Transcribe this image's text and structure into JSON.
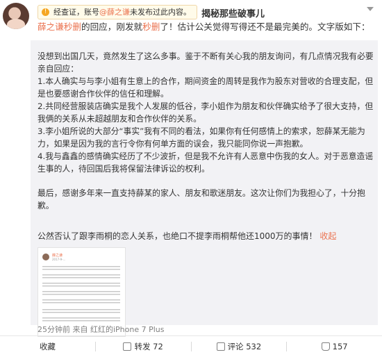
{
  "header": {
    "notice": {
      "prefix": "经查证，账号",
      "mention": "@薛之谦",
      "suffix": "未发布过此内容。"
    },
    "title": "揭秘那些破事儿"
  },
  "weibo": {
    "text": {
      "mention": "薛之谦秒删",
      "part1": "的回应，刚发就",
      "link": "秒删",
      "part2": "了！估计公关觉得写得还不是最完美的。文字版如下："
    }
  },
  "repost": {
    "intro": "没想到出国几天，竟然发生了这么多事。鉴于不断有关心我的朋友询问，有几点情况我有必要亲自回应：",
    "points": [
      "1.本人确实与与李小姐有生意上的合作，期间资金的周转是我作为股东对营收的合理支配，但是也要感谢合作伙伴的信任和理解。",
      "2.共同经营服装店确实是我个人发展的低谷，李小姐作为朋友和伙伴确实给予了很大支持，但我俩的关系从未超越朋友和合作伙伴的关系。",
      "3.李小姐所说的大部分“事实”我有不同的看法，如果你有任何感情上的索求，恕薛某无能为力，如果是因为我的言行令你有何单方面的误会，我只能同你说一声抱歉。",
      "4.我与鑫鑫的感情确实经历了不少波折，但是我不允许有人恶意中伤我的女人。对于恶意造谣生事的人，待回国后我将保留法律诉讼的权利。"
    ],
    "closing": "最后，感谢多年来一直支持薛某的家人、朋友和歌迷朋友。这次让你们为我担心了，十分抱歉。",
    "summary": "公然否认了跟李雨桐的恋人关系，也绝口不提李雨桐帮他还1000万的事情！",
    "collapse": "收起",
    "thumbnail": {
      "name": "薛之谦",
      "time": "2017-9-..."
    }
  },
  "meta": "25分钟前 来自 红红的iPhone 7 Plus",
  "actions": {
    "collect": "收藏",
    "repost": "转发 72",
    "comment": "评论 532",
    "like": "157"
  },
  "colors": {
    "accent": "#eb7350",
    "repost_bg": "#f2f2f5",
    "notice_bg": "#fffbea",
    "notice_icon": "#f5a623"
  }
}
